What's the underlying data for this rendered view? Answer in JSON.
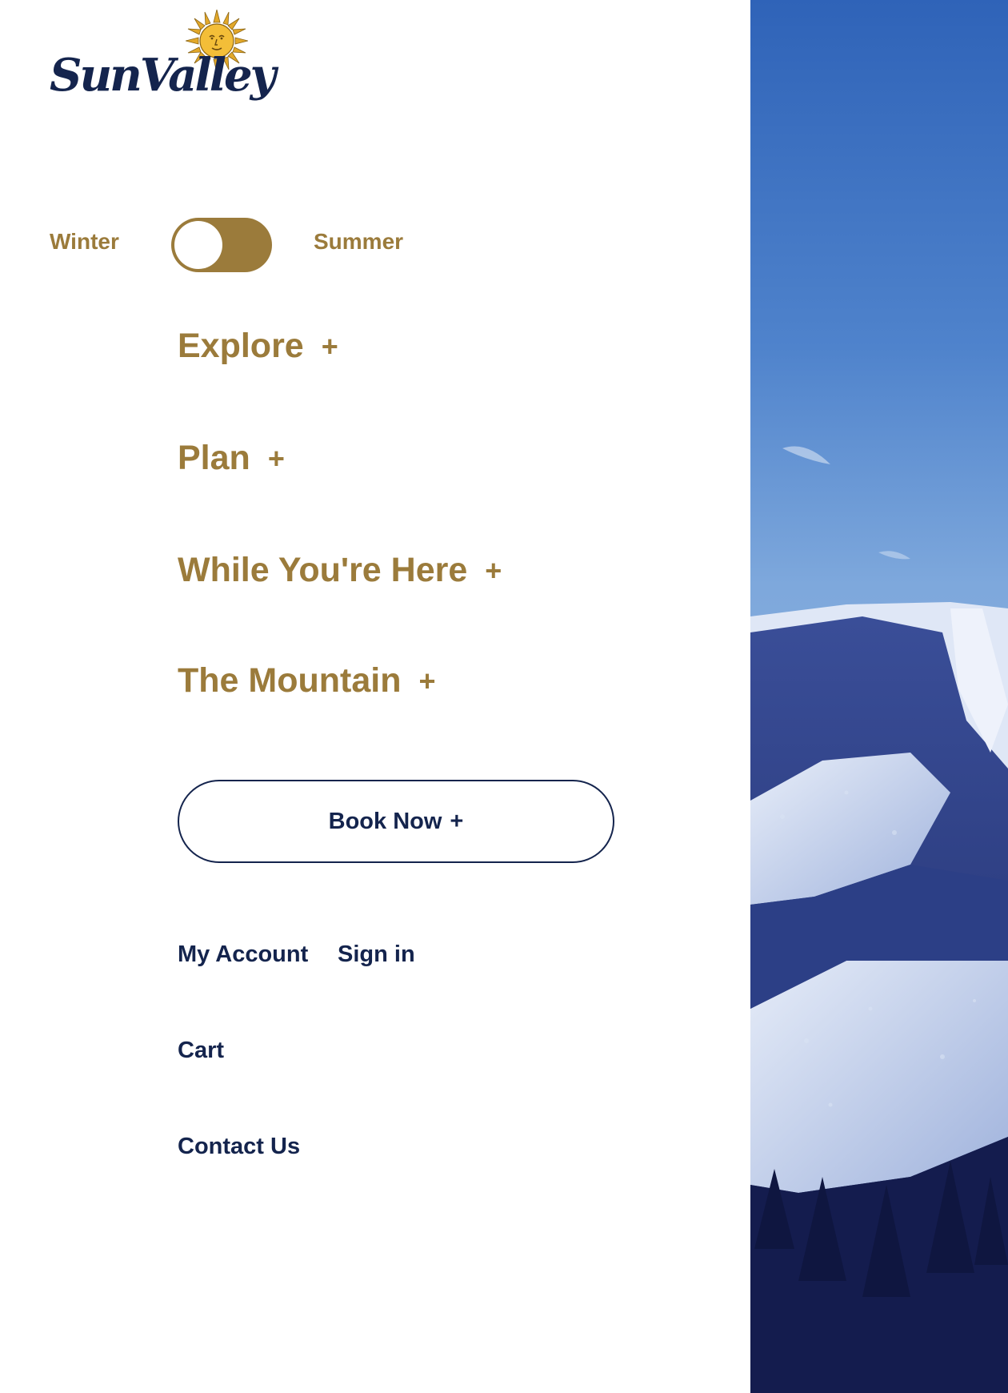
{
  "brand": {
    "logo_text": "SunValley",
    "logo_icon": "sun-face-icon"
  },
  "season_toggle": {
    "left_label": "Winter",
    "right_label": "Summer",
    "selected": "Winter"
  },
  "nav": {
    "items": [
      {
        "label": "Explore",
        "expand_icon": "+"
      },
      {
        "label": "Plan",
        "expand_icon": "+"
      },
      {
        "label": "While You're Here",
        "expand_icon": "+"
      },
      {
        "label": "The Mountain",
        "expand_icon": "+"
      }
    ]
  },
  "book_now": {
    "label": "Book Now",
    "icon": "+"
  },
  "utility": {
    "account": "My Account",
    "sign_in": "Sign in",
    "cart": "Cart",
    "contact": "Contact Us"
  },
  "colors": {
    "gold": "#9b7b3b",
    "navy": "#14244d",
    "sky": "#3c6fc0"
  },
  "photo": {
    "icon": "snowy-mountain-image"
  }
}
